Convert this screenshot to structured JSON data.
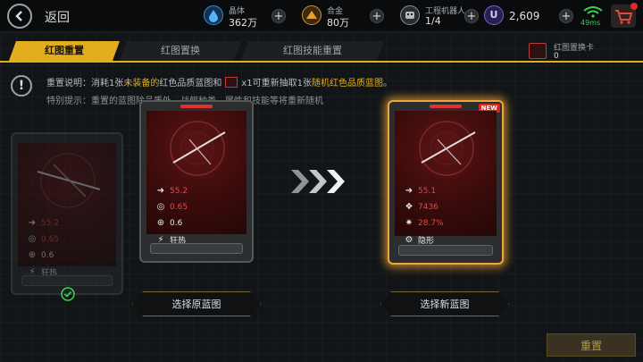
{
  "header": {
    "back_label": "返回",
    "resources": [
      {
        "name": "crystal",
        "label": "晶体",
        "value": "362万",
        "icon": "crystal-drop-icon",
        "color": "#2f8fd8"
      },
      {
        "name": "alloy",
        "label": "合金",
        "value": "80万",
        "icon": "alloy-icon",
        "color": "#d8901f"
      },
      {
        "name": "robot",
        "label": "工程机器人",
        "value": "1/4",
        "icon": "robot-icon",
        "color": "#8a8f92"
      },
      {
        "name": "currency",
        "label": "",
        "value": "2,609",
        "icon": "premium-currency-icon",
        "color": "#7b5fd6"
      }
    ],
    "ping": "49ms"
  },
  "tabs": [
    {
      "label": "红图重置",
      "active": true
    },
    {
      "label": "红图置换",
      "active": false
    },
    {
      "label": "红图技能重置",
      "active": false
    }
  ],
  "card_counter": {
    "label": "红图置换卡",
    "value": "0"
  },
  "info": {
    "line1_a": "重置说明：消耗1张",
    "line1_b": "未装备的",
    "line1_c": "红色品质蓝图和",
    "line1_d": "x1可重新抽取1张",
    "line1_e": "随机红色品质蓝图",
    "line1_f": "。",
    "line2": "特别提示：重置的蓝图除品质外，战舰种类、属性和技能等将重新随机"
  },
  "cards": {
    "faded": {
      "stats": [
        "55.2",
        "0.65",
        "0.6",
        "狂热"
      ]
    },
    "original": {
      "stats": [
        "55.2",
        "0.65",
        "0.6",
        "狂热"
      ]
    },
    "new": {
      "badge": "NEW",
      "stats": [
        "55.1",
        "7436",
        "28.7%",
        "隐形"
      ]
    }
  },
  "buttons": {
    "select_original": "选择原蓝图",
    "select_new": "选择新蓝图",
    "reset": "重置"
  },
  "colors": {
    "accent": "#e2ae1d",
    "red": "#e34848",
    "glow": "#f0a53a"
  }
}
